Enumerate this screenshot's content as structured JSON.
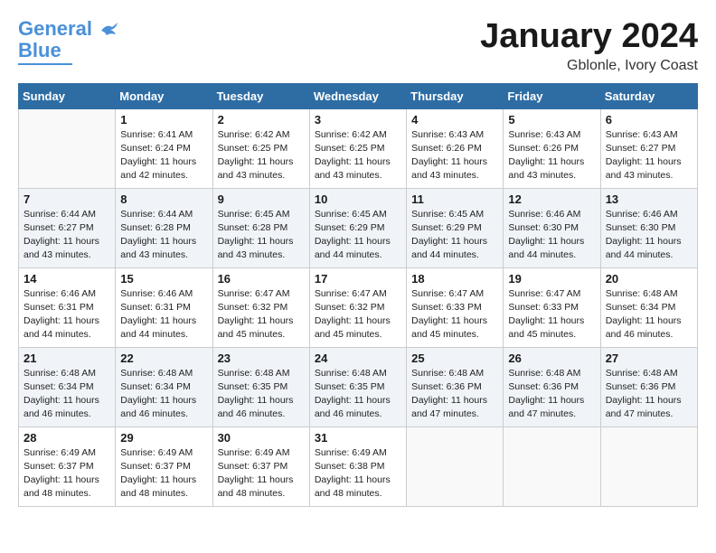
{
  "logo": {
    "line1": "General",
    "line2": "Blue"
  },
  "title": {
    "month": "January 2024",
    "location": "Gblonle, Ivory Coast"
  },
  "weekdays": [
    "Sunday",
    "Monday",
    "Tuesday",
    "Wednesday",
    "Thursday",
    "Friday",
    "Saturday"
  ],
  "weeks": [
    [
      {
        "day": "",
        "sunrise": "",
        "sunset": "",
        "daylight": ""
      },
      {
        "day": "1",
        "sunrise": "Sunrise: 6:41 AM",
        "sunset": "Sunset: 6:24 PM",
        "daylight": "Daylight: 11 hours and 42 minutes."
      },
      {
        "day": "2",
        "sunrise": "Sunrise: 6:42 AM",
        "sunset": "Sunset: 6:25 PM",
        "daylight": "Daylight: 11 hours and 43 minutes."
      },
      {
        "day": "3",
        "sunrise": "Sunrise: 6:42 AM",
        "sunset": "Sunset: 6:25 PM",
        "daylight": "Daylight: 11 hours and 43 minutes."
      },
      {
        "day": "4",
        "sunrise": "Sunrise: 6:43 AM",
        "sunset": "Sunset: 6:26 PM",
        "daylight": "Daylight: 11 hours and 43 minutes."
      },
      {
        "day": "5",
        "sunrise": "Sunrise: 6:43 AM",
        "sunset": "Sunset: 6:26 PM",
        "daylight": "Daylight: 11 hours and 43 minutes."
      },
      {
        "day": "6",
        "sunrise": "Sunrise: 6:43 AM",
        "sunset": "Sunset: 6:27 PM",
        "daylight": "Daylight: 11 hours and 43 minutes."
      }
    ],
    [
      {
        "day": "7",
        "sunrise": "Sunrise: 6:44 AM",
        "sunset": "Sunset: 6:27 PM",
        "daylight": "Daylight: 11 hours and 43 minutes."
      },
      {
        "day": "8",
        "sunrise": "Sunrise: 6:44 AM",
        "sunset": "Sunset: 6:28 PM",
        "daylight": "Daylight: 11 hours and 43 minutes."
      },
      {
        "day": "9",
        "sunrise": "Sunrise: 6:45 AM",
        "sunset": "Sunset: 6:28 PM",
        "daylight": "Daylight: 11 hours and 43 minutes."
      },
      {
        "day": "10",
        "sunrise": "Sunrise: 6:45 AM",
        "sunset": "Sunset: 6:29 PM",
        "daylight": "Daylight: 11 hours and 44 minutes."
      },
      {
        "day": "11",
        "sunrise": "Sunrise: 6:45 AM",
        "sunset": "Sunset: 6:29 PM",
        "daylight": "Daylight: 11 hours and 44 minutes."
      },
      {
        "day": "12",
        "sunrise": "Sunrise: 6:46 AM",
        "sunset": "Sunset: 6:30 PM",
        "daylight": "Daylight: 11 hours and 44 minutes."
      },
      {
        "day": "13",
        "sunrise": "Sunrise: 6:46 AM",
        "sunset": "Sunset: 6:30 PM",
        "daylight": "Daylight: 11 hours and 44 minutes."
      }
    ],
    [
      {
        "day": "14",
        "sunrise": "Sunrise: 6:46 AM",
        "sunset": "Sunset: 6:31 PM",
        "daylight": "Daylight: 11 hours and 44 minutes."
      },
      {
        "day": "15",
        "sunrise": "Sunrise: 6:46 AM",
        "sunset": "Sunset: 6:31 PM",
        "daylight": "Daylight: 11 hours and 44 minutes."
      },
      {
        "day": "16",
        "sunrise": "Sunrise: 6:47 AM",
        "sunset": "Sunset: 6:32 PM",
        "daylight": "Daylight: 11 hours and 45 minutes."
      },
      {
        "day": "17",
        "sunrise": "Sunrise: 6:47 AM",
        "sunset": "Sunset: 6:32 PM",
        "daylight": "Daylight: 11 hours and 45 minutes."
      },
      {
        "day": "18",
        "sunrise": "Sunrise: 6:47 AM",
        "sunset": "Sunset: 6:33 PM",
        "daylight": "Daylight: 11 hours and 45 minutes."
      },
      {
        "day": "19",
        "sunrise": "Sunrise: 6:47 AM",
        "sunset": "Sunset: 6:33 PM",
        "daylight": "Daylight: 11 hours and 45 minutes."
      },
      {
        "day": "20",
        "sunrise": "Sunrise: 6:48 AM",
        "sunset": "Sunset: 6:34 PM",
        "daylight": "Daylight: 11 hours and 46 minutes."
      }
    ],
    [
      {
        "day": "21",
        "sunrise": "Sunrise: 6:48 AM",
        "sunset": "Sunset: 6:34 PM",
        "daylight": "Daylight: 11 hours and 46 minutes."
      },
      {
        "day": "22",
        "sunrise": "Sunrise: 6:48 AM",
        "sunset": "Sunset: 6:34 PM",
        "daylight": "Daylight: 11 hours and 46 minutes."
      },
      {
        "day": "23",
        "sunrise": "Sunrise: 6:48 AM",
        "sunset": "Sunset: 6:35 PM",
        "daylight": "Daylight: 11 hours and 46 minutes."
      },
      {
        "day": "24",
        "sunrise": "Sunrise: 6:48 AM",
        "sunset": "Sunset: 6:35 PM",
        "daylight": "Daylight: 11 hours and 46 minutes."
      },
      {
        "day": "25",
        "sunrise": "Sunrise: 6:48 AM",
        "sunset": "Sunset: 6:36 PM",
        "daylight": "Daylight: 11 hours and 47 minutes."
      },
      {
        "day": "26",
        "sunrise": "Sunrise: 6:48 AM",
        "sunset": "Sunset: 6:36 PM",
        "daylight": "Daylight: 11 hours and 47 minutes."
      },
      {
        "day": "27",
        "sunrise": "Sunrise: 6:48 AM",
        "sunset": "Sunset: 6:36 PM",
        "daylight": "Daylight: 11 hours and 47 minutes."
      }
    ],
    [
      {
        "day": "28",
        "sunrise": "Sunrise: 6:49 AM",
        "sunset": "Sunset: 6:37 PM",
        "daylight": "Daylight: 11 hours and 48 minutes."
      },
      {
        "day": "29",
        "sunrise": "Sunrise: 6:49 AM",
        "sunset": "Sunset: 6:37 PM",
        "daylight": "Daylight: 11 hours and 48 minutes."
      },
      {
        "day": "30",
        "sunrise": "Sunrise: 6:49 AM",
        "sunset": "Sunset: 6:37 PM",
        "daylight": "Daylight: 11 hours and 48 minutes."
      },
      {
        "day": "31",
        "sunrise": "Sunrise: 6:49 AM",
        "sunset": "Sunset: 6:38 PM",
        "daylight": "Daylight: 11 hours and 48 minutes."
      },
      {
        "day": "",
        "sunrise": "",
        "sunset": "",
        "daylight": ""
      },
      {
        "day": "",
        "sunrise": "",
        "sunset": "",
        "daylight": ""
      },
      {
        "day": "",
        "sunrise": "",
        "sunset": "",
        "daylight": ""
      }
    ]
  ]
}
